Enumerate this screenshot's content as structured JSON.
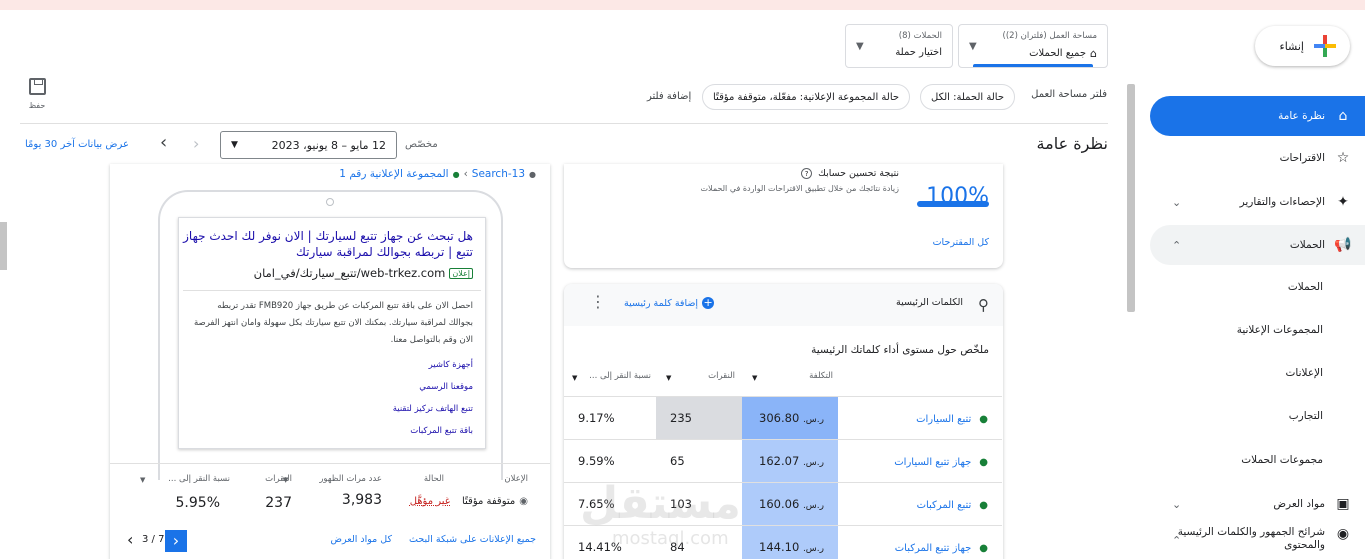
{
  "create": {
    "label": "إنشاء"
  },
  "sidebar": {
    "items": [
      {
        "label": "نظرة عامة"
      },
      {
        "label": "الاقتراحات"
      },
      {
        "label": "الإحصاءات والتقارير"
      },
      {
        "label": "الحملات"
      },
      {
        "label": "الحملات"
      },
      {
        "label": "المجموعات الإعلانية"
      },
      {
        "label": "الإعلانات"
      },
      {
        "label": "التجارب"
      },
      {
        "label": "مجموعات الحملات"
      },
      {
        "label": "مواد العرض"
      },
      {
        "label": "شرائح الجمهور والكلمات الرئيسية والمحتوى"
      }
    ]
  },
  "workspace": {
    "small": "مساحة العمل (فلتران (2))",
    "value": "جميع الحملات"
  },
  "campaigns_dd": {
    "small": "الحملات (8)",
    "value": "اختيار حملة"
  },
  "save": {
    "label": "حفظ"
  },
  "filters": {
    "label": "فلتر مساحة العمل",
    "chip1": "حالة الحملة: الكل",
    "chip2": "حالة المجموعة الإعلانية: مفعّلة، متوقفة مؤقتًا",
    "add": "إضافة فلتر"
  },
  "page": {
    "title": "نظرة عامة"
  },
  "date": {
    "custom": "مخصّص",
    "range": "12 مايو – 8 يونيو، 2023",
    "last30": "عرض بيانات آخر 30 يومًا"
  },
  "ad_card": {
    "breadcrumb_campaign": "Search-13",
    "breadcrumb_group": "المجموعة الإعلانية رقم 1",
    "headline": "هل تبحث عن جهاز تتبع لسيارتك | الان نوفر لك احدث جهاز تتبع | تربطه بجوالك لمراقبة سيارتك",
    "badge": "إعلان",
    "url": "web-trkez.com/تتبع_سيارتك/في_امان",
    "body": "احصل الان على باقة تتبع المركبات عن طريق جهاز FMB920 تقدر تربطه بجوالك لمراقبة سيارتك. بمكنك الان تتبع سيارتك بكل سهولة وامان انتهز الفرصة الان وقم بالتواصل معنا.",
    "links": [
      "أجهزة كاشير",
      "موقعنا الرسمي",
      "تتبع الهاتف تركيز لتقنية",
      "باقة تتبع المركبات"
    ],
    "cols": {
      "ad": "الإعلان",
      "status": "الحالة",
      "impr": "عدد مرات الظهور",
      "clicks": "النقرات",
      "ctr": "نسبة النقر إلى ..."
    },
    "vals": {
      "ad": "متوقفة مؤقتًا",
      "status": "غير مؤهَّل",
      "impr": "3,983",
      "clicks": "237",
      "ctr": "5.95%"
    },
    "footer": {
      "all_search": "جميع الإعلانات على شبكة البحث",
      "all_assets": "كل مواد العرض",
      "pager": "3 / 7"
    }
  },
  "opt_card": {
    "title": "نتيجة تحسين حسابك",
    "desc": "زيادة نتائجك من خلال تطبيق الاقتراحات الواردة في الحملات",
    "score": "100%",
    "score_value": 100,
    "all_link": "كل المقترحات"
  },
  "kw_card": {
    "title": "الكلمات الرئيسية",
    "add": "إضافة كلمة رئيسية",
    "summary": "ملخّص حول مستوى أداء كلماتك الرئيسية",
    "cols": {
      "cost": "التكلفة",
      "clicks": "النقرات",
      "ctr": "نسبة النقر إلى ..."
    },
    "rows": [
      {
        "kw": "تتبع السيارات",
        "cost": "306.80",
        "currency": "ر.س.",
        "clicks": "235",
        "ctr": "9.17%"
      },
      {
        "kw": "جهاز تتبع السيارات",
        "cost": "162.07",
        "currency": "ر.س.",
        "clicks": "65",
        "ctr": "9.59%"
      },
      {
        "kw": "تتبع المركبات",
        "cost": "160.06",
        "currency": "ر.س.",
        "clicks": "103",
        "ctr": "7.65%"
      },
      {
        "kw": "جهاز تتبع المركبات",
        "cost": "144.10",
        "currency": "ر.س.",
        "clicks": "84",
        "ctr": "14.41%"
      }
    ]
  },
  "watermark": {
    "ar": "مستقل",
    "en": "mostaql.com"
  }
}
